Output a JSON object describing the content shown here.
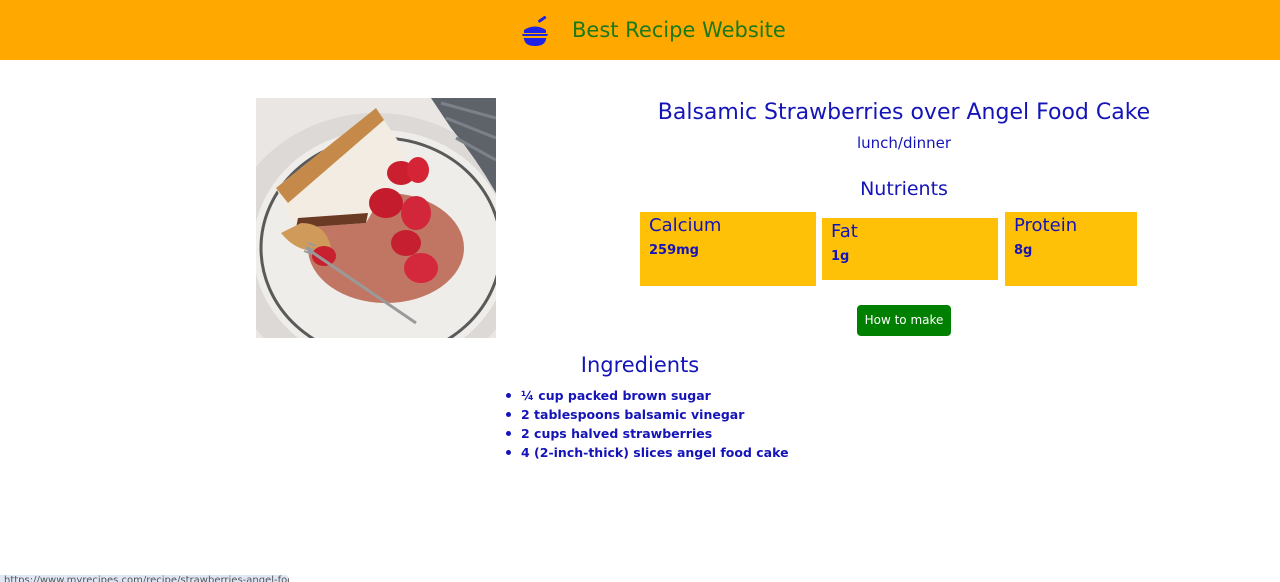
{
  "header": {
    "logo_icon": "cooking-pot-icon",
    "title": "Best Recipe Website",
    "background_color": "#ffa800",
    "title_color": "#1a7a1a"
  },
  "recipe": {
    "image": "strawberries-angel-food-cake-photo",
    "title": "Balsamic Strawberries over Angel Food Cake",
    "category": "lunch/dinner",
    "text_color": "#1414b8"
  },
  "nutrients": {
    "heading": "Nutrients",
    "card_color": "#ffc107",
    "items": [
      {
        "name": "Calcium",
        "value": "259mg"
      },
      {
        "name": "Fat",
        "value": "1g"
      },
      {
        "name": "Protein",
        "value": "8g"
      }
    ]
  },
  "actions": {
    "how_to_make_label": "How to make",
    "button_color": "#008000"
  },
  "ingredients": {
    "heading": "Ingredients",
    "items": [
      "¼ cup packed brown sugar",
      "2 tablespoons balsamic vinegar",
      "2 cups halved strawberries",
      "4 (2-inch-thick) slices angel food cake"
    ]
  },
  "status_bar": {
    "url": "https://www.myrecipes.com/recipe/strawberries-angel-food-cake"
  }
}
